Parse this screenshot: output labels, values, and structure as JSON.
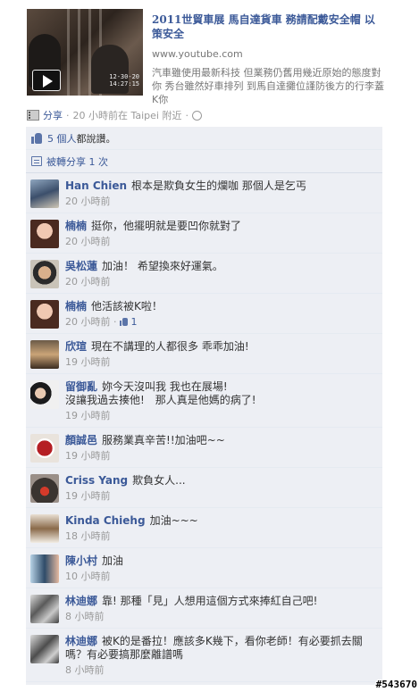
{
  "post": {
    "link_title": "2011世貿車展 馬自達貨車 務請配戴安全帽 以策安全",
    "link_url": "www.youtube.com",
    "link_description": "汽車雖使用最新科技 但業務仍舊用幾近原始的態度對你 秀台雖然好車排列 到馬自達攤位謹防後方的行李蓋K你",
    "video_timestamp": [
      "12-30-20",
      "14:27:15"
    ],
    "icons": {
      "video": "film-icon",
      "play": "play-icon",
      "privacy": "globe-icon"
    }
  },
  "meta": {
    "share_label": "分享",
    "separator": "·",
    "time_location": "20 小時前在 Taipei 附近",
    "separator2": "·"
  },
  "feedback": {
    "likes_link": "5 個人",
    "likes_suffix": "都說讚。",
    "shares_text": "被轉分享 1 次"
  },
  "comments": [
    {
      "author": "Han Chien",
      "text": "根本是欺負女生的爛咖 那個人是乞丐",
      "time": "20 小時前",
      "likes": ""
    },
    {
      "author": "楠楠",
      "text": "挺你，他擺明就是要凹你就對了",
      "time": "20 小時前",
      "likes": ""
    },
    {
      "author": "吳松蓮",
      "text": "加油！ 希望換來好運氣。",
      "time": "20 小時前",
      "likes": ""
    },
    {
      "author": "楠楠",
      "text": "他活該被K啦！",
      "time": "20 小時前 ·",
      "likes": "1"
    },
    {
      "author": "欣瑄",
      "text": "現在不講理的人都很多 乖乖加油!",
      "time": "19 小時前",
      "likes": ""
    },
    {
      "author": "留御亂",
      "text": "妳今天沒叫我 我也在展場!",
      "text2": "沒讓我過去揍他!　那人真是他媽的病了!",
      "time": "19 小時前",
      "likes": ""
    },
    {
      "author": "顏誠邑",
      "text": "服務業真辛苦!!加油吧~~",
      "time": "19 小時前",
      "likes": ""
    },
    {
      "author": "Criss Yang",
      "text": "欺負女人...",
      "time": "19 小時前",
      "likes": ""
    },
    {
      "author": "Kinda Chiehg",
      "text": "加油~~~",
      "time": "18 小時前",
      "likes": ""
    },
    {
      "author": "陳小村",
      "text": "加油",
      "time": "10 小時前",
      "likes": ""
    },
    {
      "author": "林迪娜",
      "text": "靠! 那種「見」人想用這個方式來捧紅自己吧!",
      "time": "8 小時前",
      "likes": ""
    },
    {
      "author": "林迪娜",
      "text": "被K的是番拉！應該多K幾下，看你老師！有必要抓去關",
      "text2": "嗎？有必要搞那麼離譜嗎",
      "time": "8 小時前",
      "likes": ""
    }
  ],
  "watermark": "#543670"
}
